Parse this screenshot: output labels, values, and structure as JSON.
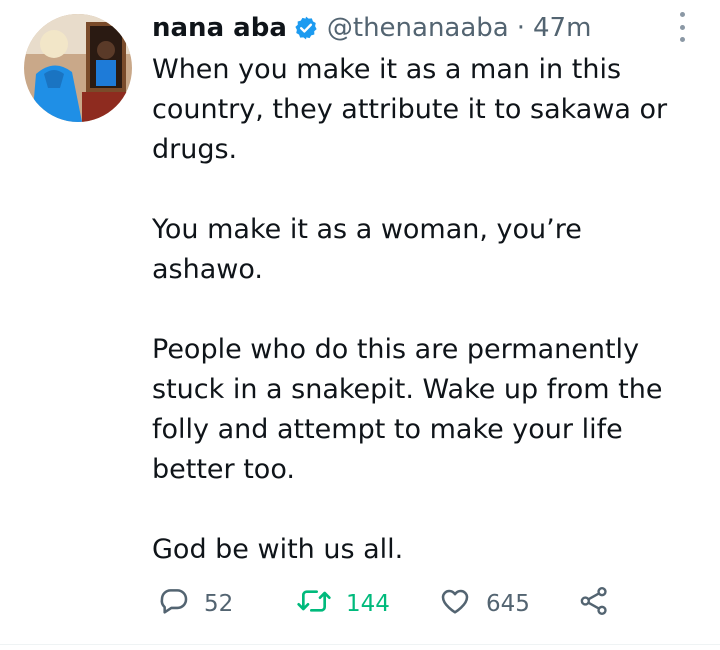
{
  "author": {
    "name": "nana aba",
    "handle": "@thenanaaba",
    "separator": "·",
    "time": "47m",
    "verified": true
  },
  "tweet": {
    "paragraphs": [
      "When you make it as a man in this country, they attribute it to sakawa or drugs.",
      "You make it as a woman, you’re ashawo.",
      "People who do this are permanently stuck in a snakepit. Wake up from the folly and attempt to make your life better too.",
      "God be with us all."
    ]
  },
  "actions": {
    "reply_count": "52",
    "retweet_count": "144",
    "like_count": "645"
  },
  "colors": {
    "text": "#0f1419",
    "secondary": "#536471",
    "verified": "#1d9bf0",
    "retweet_active": "#00ba7c"
  },
  "icons": [
    "verified-badge-icon",
    "more-options-icon",
    "reply-icon",
    "retweet-icon",
    "like-icon",
    "share-icon"
  ]
}
